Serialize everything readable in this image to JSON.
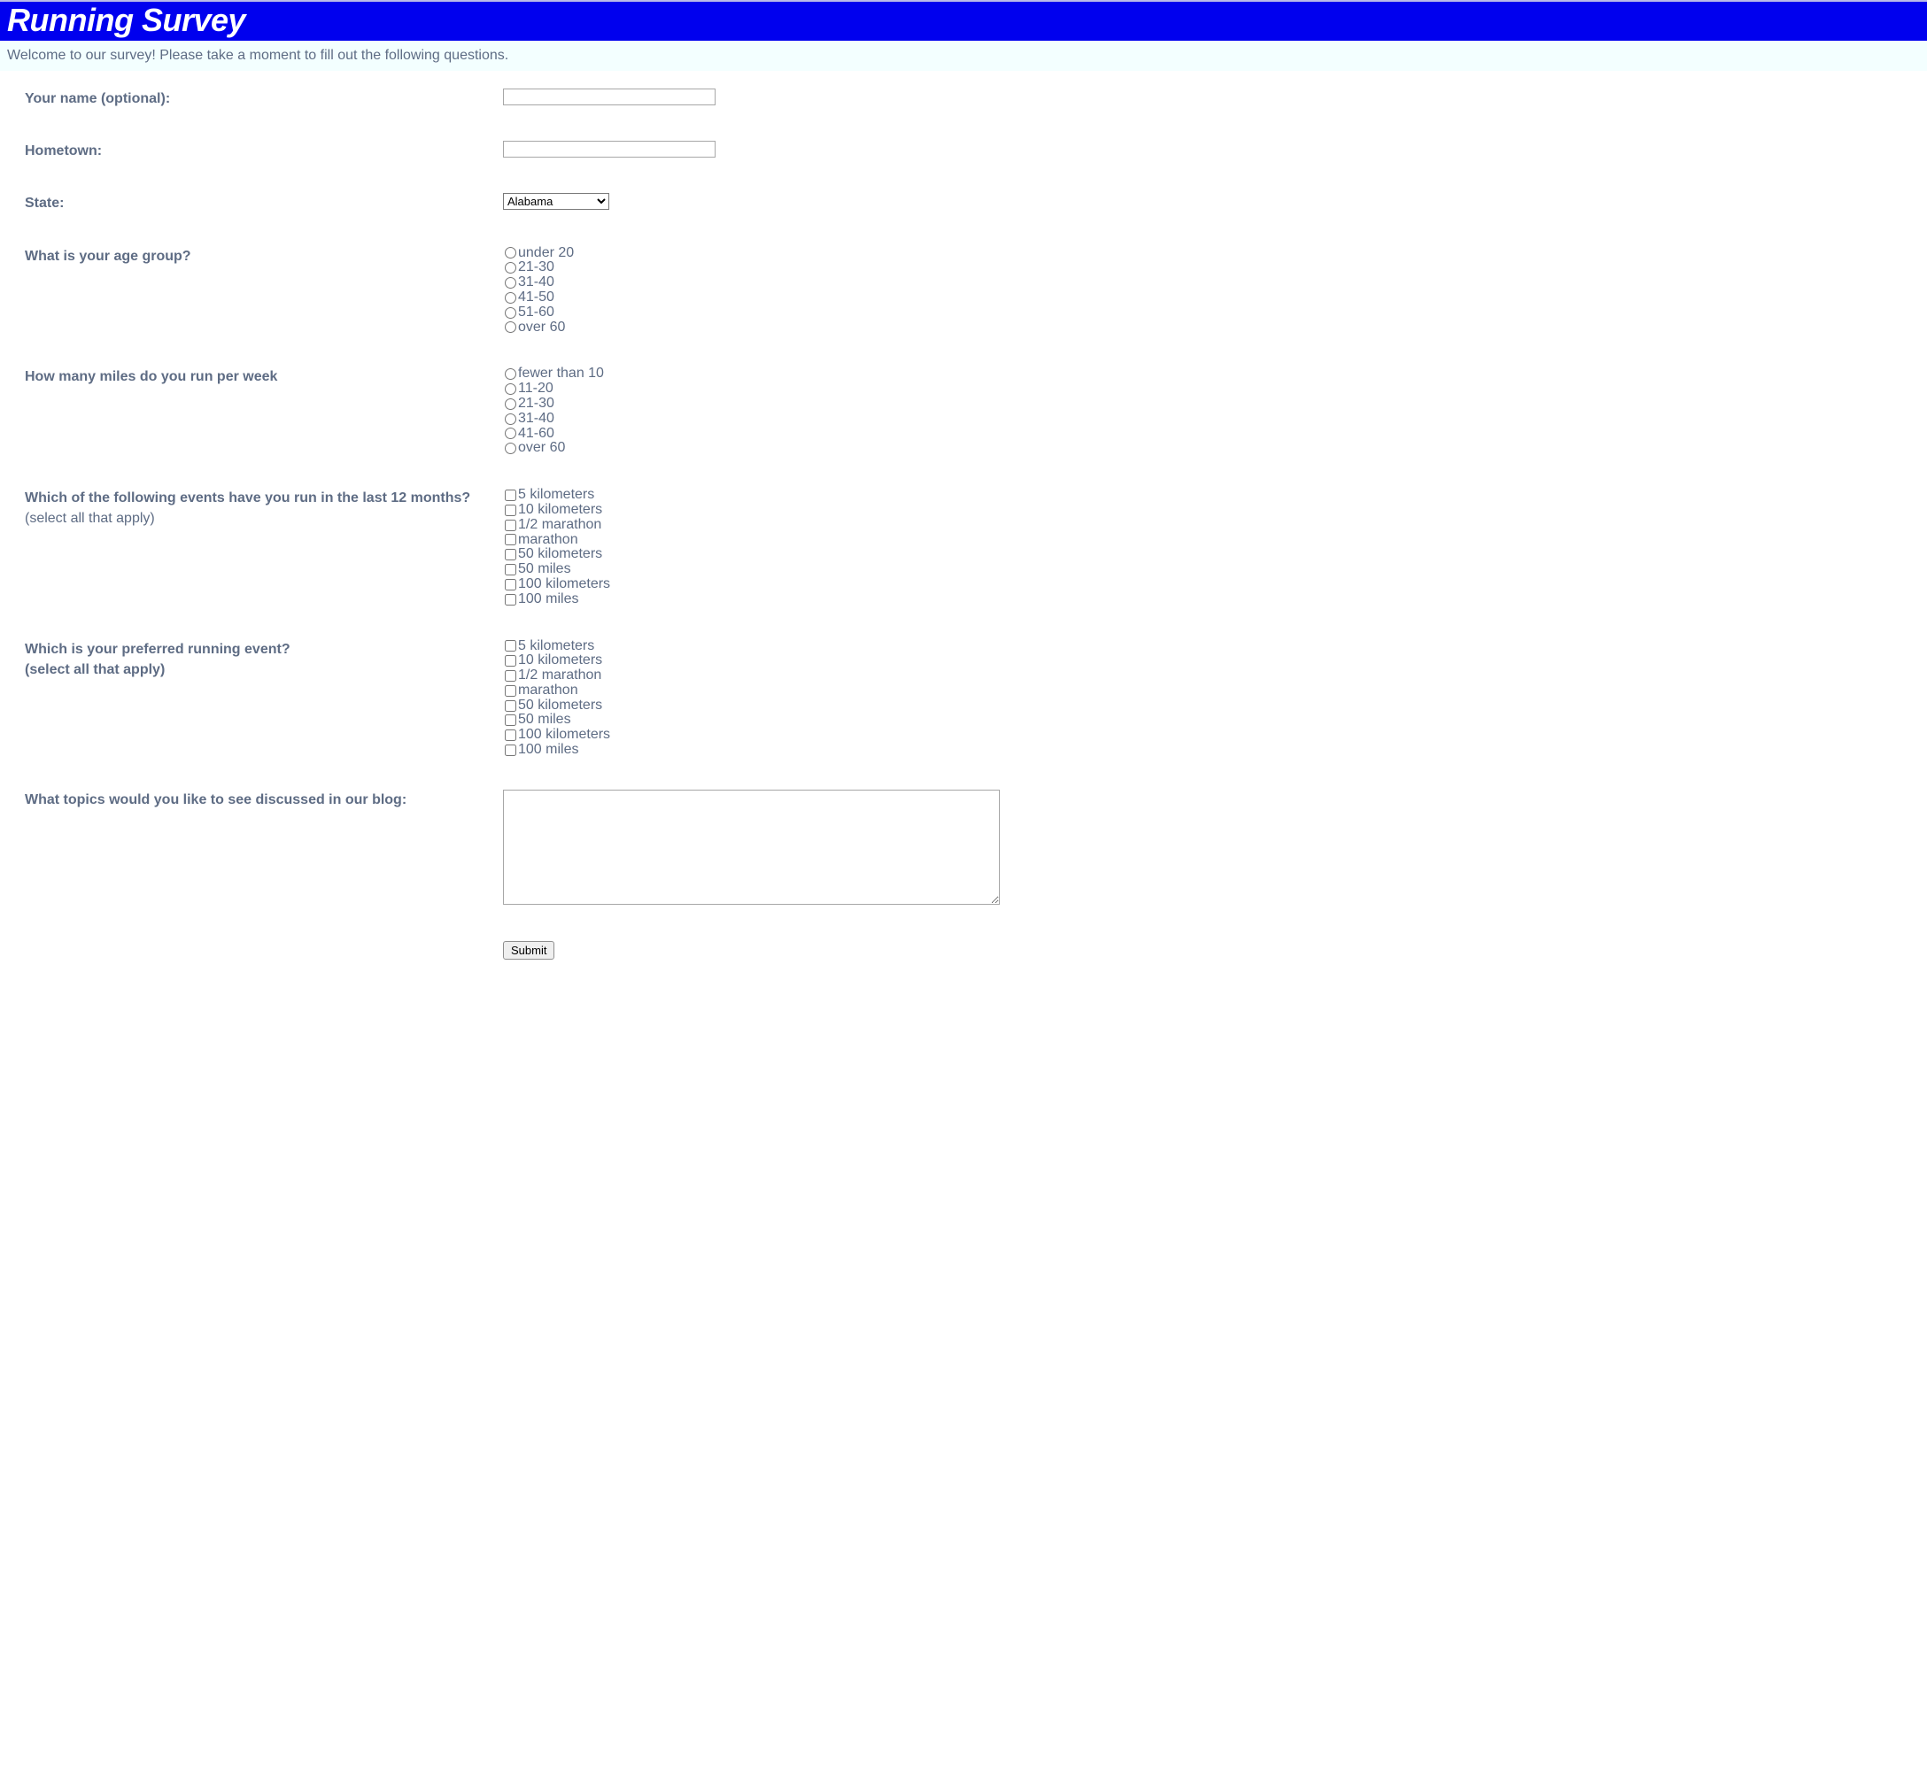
{
  "header": {
    "title": "Running Survey"
  },
  "welcome": "Welcome to our survey! Please take a moment to fill out the following questions.",
  "fields": {
    "name_label": "Your name (optional):",
    "hometown_label": "Hometown:",
    "state_label": "State:",
    "state_selected": "Alabama",
    "age_label": "What is your age group?",
    "age_options": {
      "o0": "under 20",
      "o1": "21-30",
      "o2": "31-40",
      "o3": "41-50",
      "o4": "51-60",
      "o5": "over 60"
    },
    "miles_label": "How many miles do you run per week",
    "miles_options": {
      "o0": "fewer than 10",
      "o1": "11-20",
      "o2": "21-30",
      "o3": "31-40",
      "o4": "41-60",
      "o5": "over 60"
    },
    "events_label_bold": "Which of the following events have you run in the last 12 months?",
    "events_label_plain": "(select all that apply)",
    "event_options": {
      "o0": "5 kilometers",
      "o1": "10 kilometers",
      "o2": "1/2 marathon",
      "o3": "marathon",
      "o4": "50 kilometers",
      "o5": "50 miles",
      "o6": "100 kilometers",
      "o7": "100 miles"
    },
    "preferred_label_bold": "Which is your preferred running event?",
    "preferred_label_plain": "(select all that apply)",
    "topics_label": "What topics would you like to see discussed in our blog:",
    "submit_label": "Submit"
  }
}
